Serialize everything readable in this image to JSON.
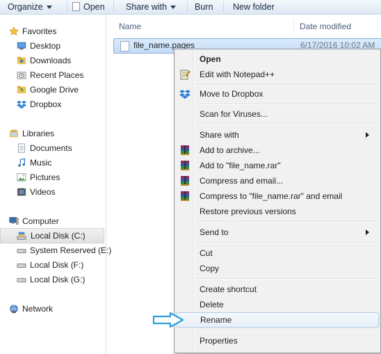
{
  "toolbar": {
    "organize": "Organize",
    "open": "Open",
    "share_with": "Share with",
    "burn": "Burn",
    "new_folder": "New folder"
  },
  "nav": {
    "favorites": {
      "label": "Favorites",
      "icon": "star-icon",
      "items": [
        "Desktop",
        "Downloads",
        "Recent Places",
        "Google Drive",
        "Dropbox"
      ]
    },
    "libraries": {
      "label": "Libraries",
      "icon": "library-icon",
      "items": [
        "Documents",
        "Music",
        "Pictures",
        "Videos"
      ]
    },
    "computer": {
      "label": "Computer",
      "icon": "computer-icon",
      "items": [
        "Local Disk (C:)",
        "System Reserved (E:)",
        "Local Disk (F:)",
        "Local Disk (G:)"
      ],
      "selected": "Local Disk (C:)"
    },
    "network": {
      "label": "Network",
      "icon": "network-icon"
    }
  },
  "list": {
    "columns": [
      "Name",
      "Date modified"
    ],
    "files": [
      {
        "name": "file_name.pages",
        "date": "6/17/2016 10:02 AM"
      }
    ]
  },
  "context_menu": {
    "items": [
      {
        "label": "Open",
        "bold": true
      },
      {
        "label": "Edit with Notepad++",
        "icon": "notepad-icon"
      },
      {
        "label": "Move to Dropbox",
        "icon": "dropbox-icon"
      },
      {
        "label": "Scan for Viruses..."
      },
      {
        "label": "Share with",
        "submenu": true
      },
      {
        "label": "Add to archive...",
        "icon": "winrar-icon"
      },
      {
        "label": "Add to \"file_name.rar\"",
        "icon": "winrar-icon"
      },
      {
        "label": "Compress and email...",
        "icon": "winrar-icon"
      },
      {
        "label": "Compress to \"file_name.rar\" and email",
        "icon": "winrar-icon"
      },
      {
        "label": "Restore previous versions"
      },
      {
        "label": "Send to",
        "submenu": true
      },
      {
        "label": "Cut"
      },
      {
        "label": "Copy"
      },
      {
        "label": "Create shortcut"
      },
      {
        "label": "Delete"
      },
      {
        "label": "Rename",
        "highlighted": true
      },
      {
        "label": "Properties"
      }
    ]
  },
  "colors": {
    "accent_arrow": "#2b9fdc",
    "selection": "#cce0f7"
  }
}
